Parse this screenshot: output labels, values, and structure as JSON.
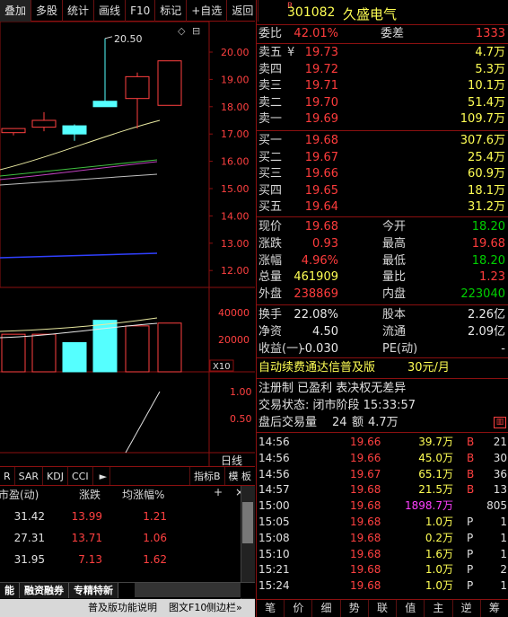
{
  "toolbar": [
    "叠加",
    "多股",
    "统计",
    "画线",
    "F10",
    "标记",
    "+自选",
    "返回"
  ],
  "chart": {
    "price_ticks": [
      "20.00",
      "19.00",
      "18.00",
      "17.00",
      "16.00",
      "15.00",
      "14.00",
      "13.00",
      "12.00"
    ],
    "high_label": "20.50",
    "vol_ticks": [
      "40000",
      "20000"
    ],
    "vol_unit": "X10",
    "ind_ticks": [
      "1.00",
      "0.50"
    ],
    "period": "日线",
    "candles": [
      {
        "o": 17.05,
        "c": 17.2,
        "h": 17.2,
        "l": 16.95
      },
      {
        "o": 17.25,
        "c": 17.5,
        "h": 17.8,
        "l": 17.1
      },
      {
        "o": 17.3,
        "c": 17.0,
        "h": 17.35,
        "l": 16.75
      },
      {
        "o": 18.2,
        "c": 18.0,
        "h": 20.5,
        "l": 18.0
      },
      {
        "o": 18.3,
        "c": 19.1,
        "h": 19.25,
        "l": 17.2
      },
      {
        "o": 18.05,
        "c": 19.68,
        "h": 19.68,
        "l": 18.05
      }
    ],
    "volumes": [
      27000,
      27000,
      21000,
      37000,
      33000,
      35000
    ]
  },
  "indicator_tabs": [
    "R",
    "SAR",
    "KDJ",
    "CCI"
  ],
  "indicator_buttons": [
    "指标B",
    "模 板"
  ],
  "table_headers": [
    "市盈(动)",
    "涨跌",
    "均涨幅%"
  ],
  "table_rows": [
    [
      "31.42",
      "13.99",
      "1.21"
    ],
    [
      "27.31",
      "13.71",
      "1.06"
    ],
    [
      "31.95",
      "7.13",
      "1.62"
    ]
  ],
  "bottom_tabs": [
    "能",
    "融资融券",
    "专精特新"
  ],
  "status_bar": [
    "普及版功能说明",
    "图文F10",
    "侧边栏»"
  ],
  "stock": {
    "flag": "R",
    "code": "301082",
    "name": "久盛电气"
  },
  "weibi": {
    "label": "委比",
    "value": "42.01%",
    "label2": "委差",
    "value2": "1333"
  },
  "asks": [
    {
      "label": "卖五",
      "mark": "¥",
      "price": "19.73",
      "vol": "4.7万"
    },
    {
      "label": "卖四",
      "mark": "",
      "price": "19.72",
      "vol": "5.3万"
    },
    {
      "label": "卖三",
      "mark": "",
      "price": "19.71",
      "vol": "10.1万"
    },
    {
      "label": "卖二",
      "mark": "",
      "price": "19.70",
      "vol": "51.4万"
    },
    {
      "label": "卖一",
      "mark": "",
      "price": "19.69",
      "vol": "109.7万"
    }
  ],
  "bids": [
    {
      "label": "买一",
      "price": "19.68",
      "vol": "307.6万"
    },
    {
      "label": "买二",
      "price": "19.67",
      "vol": "25.4万"
    },
    {
      "label": "买三",
      "price": "19.66",
      "vol": "60.9万"
    },
    {
      "label": "买四",
      "price": "19.65",
      "vol": "18.1万"
    },
    {
      "label": "买五",
      "price": "19.64",
      "vol": "31.2万"
    }
  ],
  "quote": [
    {
      "l1": "现价",
      "v1": "19.68",
      "c1": "red",
      "l2": "今开",
      "v2": "18.20",
      "c2": "grn"
    },
    {
      "l1": "涨跌",
      "v1": "0.93",
      "c1": "red",
      "l2": "最高",
      "v2": "19.68",
      "c2": "red"
    },
    {
      "l1": "涨幅",
      "v1": "4.96%",
      "c1": "red",
      "l2": "最低",
      "v2": "18.20",
      "c2": "grn"
    },
    {
      "l1": "总量",
      "v1": "461909",
      "c1": "yel",
      "l2": "量比",
      "v2": "1.23",
      "c2": "red"
    },
    {
      "l1": "外盘",
      "v1": "238869",
      "c1": "red",
      "l2": "内盘",
      "v2": "223040",
      "c2": "grn"
    }
  ],
  "fund": [
    {
      "l1": "换手",
      "v1": "22.08%",
      "l2": "股本",
      "v2": "2.26亿"
    },
    {
      "l1": "净资",
      "v1": "4.50",
      "l2": "流通",
      "v2": "2.09亿"
    },
    {
      "l1": "收益(一)",
      "v1": "-0.030",
      "l2": "PE(动)",
      "v2": "-"
    }
  ],
  "ad": {
    "text": "自动续费通达信普及版",
    "price": "30元/月"
  },
  "info_lines": [
    "注册制 已盈利 表决权无差异",
    "交易状态: 闭市阶段 15:33:57"
  ],
  "after_hours": {
    "label": "盘后交易量",
    "vol": "24",
    "label2": "额",
    "amt": "4.7万"
  },
  "ticks": [
    {
      "t": "14:56",
      "p": "19.66",
      "v": "39.7万",
      "s": "B",
      "n": "21",
      "vc": "yel"
    },
    {
      "t": "14:56",
      "p": "19.66",
      "v": "45.0万",
      "s": "B",
      "n": "30",
      "vc": "yel"
    },
    {
      "t": "14:56",
      "p": "19.67",
      "v": "65.1万",
      "s": "B",
      "n": "36",
      "vc": "yel"
    },
    {
      "t": "14:57",
      "p": "19.68",
      "v": "21.5万",
      "s": "B",
      "n": "13",
      "vc": "yel"
    },
    {
      "t": "15:00",
      "p": "19.68",
      "v": "1898.7万",
      "s": "",
      "n": "805",
      "vc": "mag"
    },
    {
      "t": "15:05",
      "p": "19.68",
      "v": "1.0万",
      "s": "P",
      "n": "1",
      "vc": "yel"
    },
    {
      "t": "15:08",
      "p": "19.68",
      "v": "0.2万",
      "s": "P",
      "n": "1",
      "vc": "yel"
    },
    {
      "t": "15:10",
      "p": "19.68",
      "v": "1.6万",
      "s": "P",
      "n": "1",
      "vc": "yel"
    },
    {
      "t": "15:21",
      "p": "19.68",
      "v": "1.0万",
      "s": "P",
      "n": "2",
      "vc": "yel"
    },
    {
      "t": "15:24",
      "p": "19.68",
      "v": "1.0万",
      "s": "P",
      "n": "1",
      "vc": "yel"
    }
  ],
  "right_tabs": [
    "笔",
    "价",
    "细",
    "势",
    "联",
    "值",
    "主",
    "逆",
    "筹"
  ]
}
